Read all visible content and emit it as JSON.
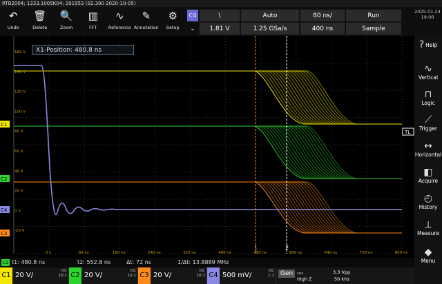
{
  "title": "RTB2004; 1333.1005K04; 201953 (02.300 2020-10-05)",
  "toolbar": [
    {
      "label": "Undo",
      "icon": "undo-icon",
      "glyph": "↶"
    },
    {
      "label": "Delete",
      "icon": "trash-icon",
      "glyph": "🗑"
    },
    {
      "label": "Zoom",
      "icon": "zoom-icon",
      "glyph": "🔍"
    },
    {
      "label": "FFT",
      "icon": "fft-icon",
      "glyph": "▥"
    },
    {
      "label": "Reference",
      "icon": "reference-icon",
      "glyph": "∿"
    },
    {
      "label": "Annotation",
      "icon": "pencil-icon",
      "glyph": "✎"
    },
    {
      "label": "Setup",
      "icon": "wrench-icon",
      "glyph": "⚙"
    }
  ],
  "trigger": {
    "source": "C4",
    "slope": "\\",
    "mode": "Auto",
    "timebase": "80 ns/",
    "run": "Run",
    "level": "1.81 V",
    "sample_rate": "1.25 GSa/s",
    "record": "400 ns",
    "acq_mode": "Sample"
  },
  "clock": {
    "date": "2025-01-24",
    "time": "19:00"
  },
  "sidebar": [
    {
      "label": "Help",
      "icon": "help-icon",
      "glyph": "?"
    },
    {
      "label": "Vertical",
      "icon": "vertical-icon",
      "glyph": "∿"
    },
    {
      "label": "Logic",
      "icon": "logic-icon",
      "glyph": "⊓"
    },
    {
      "label": "Trigger",
      "icon": "trigger-icon",
      "glyph": "⟋"
    },
    {
      "label": "Horizontal",
      "icon": "horizontal-icon",
      "glyph": "↔"
    },
    {
      "label": "Acquire",
      "icon": "acquire-icon",
      "glyph": "◧"
    },
    {
      "label": "History",
      "icon": "history-icon",
      "glyph": "◴"
    },
    {
      "label": "Measure",
      "icon": "measure-icon",
      "glyph": "⟂"
    },
    {
      "label": "Menu",
      "icon": "menu-icon",
      "glyph": "◆"
    }
  ],
  "cursor_box": "X1-Position: 480.8 ns",
  "y_labels": [
    "160 V",
    "140 V",
    "120 V",
    "100 V",
    "80 V",
    "60 V",
    "40 V",
    "20 V",
    "0 V",
    "-20 V"
  ],
  "x_labels": [
    "0 s",
    "80 ns",
    "160 ns",
    "240 ns",
    "320 ns",
    "400 ns",
    "480 ns",
    "560 ns",
    "640 ns",
    "720 ns",
    "800 ns"
  ],
  "markers": {
    "c1": "C1",
    "c2": "C2",
    "c3": "C3",
    "c4": "C4",
    "tl": "TL",
    "cursor1": "1",
    "cursor2": "2"
  },
  "status": {
    "tag": "C2",
    "t1": "t1: 480.8 ns",
    "t2": "t2: 552.8 ns",
    "dt": "Δt: 72 ns",
    "inv": "1/Δt: 13.8889 MHz"
  },
  "channels": [
    {
      "name": "C1",
      "value": "20 V/",
      "coupling": "DC",
      "probe": "10:1",
      "color": "#f2e600"
    },
    {
      "name": "C2",
      "value": "20 V/",
      "coupling": "DC",
      "probe": "10:1",
      "color": "#2bd42b"
    },
    {
      "name": "C3",
      "value": "20 V/",
      "coupling": "DC",
      "probe": "10:1",
      "color": "#ff8a1a"
    },
    {
      "name": "C4",
      "value": "500 mV/",
      "coupling": "DC",
      "probe": "1:1",
      "color": "#8a8ae6"
    }
  ],
  "gen": {
    "label": "Gen",
    "wave": "〰",
    "impedance": "High Z",
    "amplitude": "3.3 Vpp",
    "freq": "50 kHz"
  }
}
